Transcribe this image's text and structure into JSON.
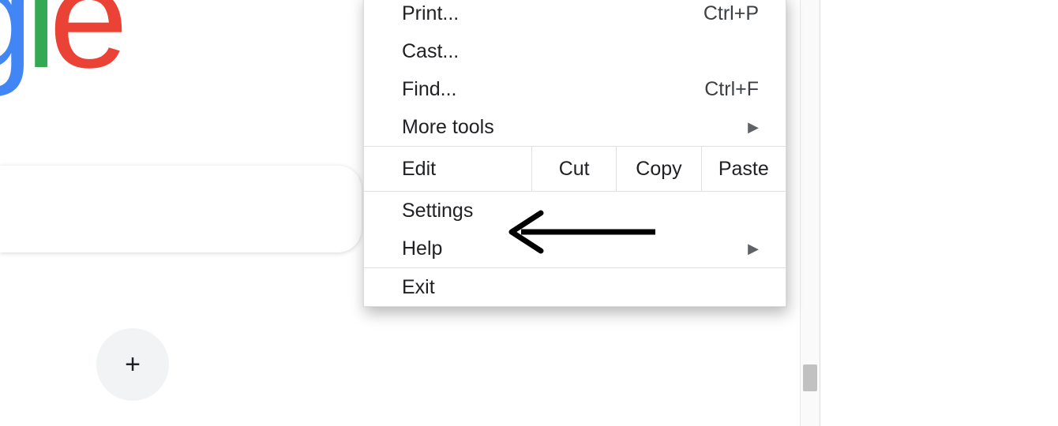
{
  "logo": {
    "g": "g",
    "l": "l",
    "e": "e"
  },
  "add_shortcut": {
    "symbol": "+"
  },
  "menu": {
    "print": {
      "label": "Print...",
      "shortcut": "Ctrl+P"
    },
    "cast": {
      "label": "Cast..."
    },
    "find": {
      "label": "Find...",
      "shortcut": "Ctrl+F"
    },
    "more_tools": {
      "label": "More tools"
    },
    "edit": {
      "label": "Edit",
      "cut": "Cut",
      "copy": "Copy",
      "paste": "Paste"
    },
    "settings": {
      "label": "Settings"
    },
    "help": {
      "label": "Help"
    },
    "exit": {
      "label": "Exit"
    }
  },
  "glyph": {
    "submenu_arrow": "▶"
  }
}
